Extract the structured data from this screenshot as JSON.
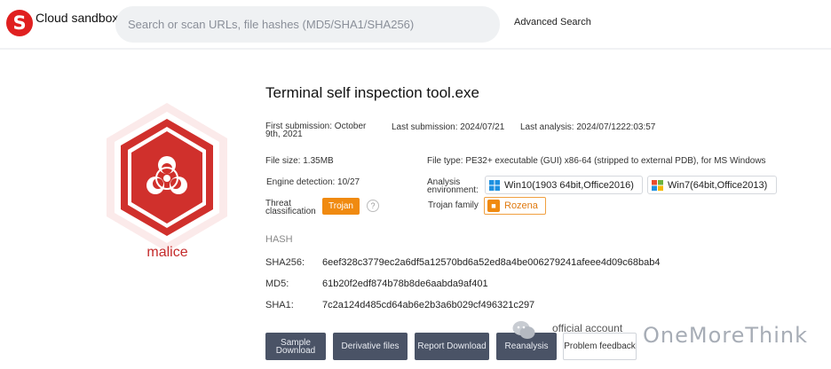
{
  "header": {
    "brand": "Cloud sandbox",
    "search_placeholder": "Search or scan URLs, file hashes (MD5/SHA1/SHA256)",
    "advanced_search": "Advanced Search"
  },
  "verdict": {
    "label": "malice",
    "icon": "biohazard-icon",
    "color": "#d0302c"
  },
  "file": {
    "name": "Terminal self inspection tool.exe",
    "first_submission": "First submission: October 9th, 2021",
    "last_submission": "Last submission: 2024/07/21",
    "last_analysis": "Last analysis: 2024/07/1222:03:57",
    "size": "File size: 1.35MB",
    "type": "File type: PE32+ executable (GUI) x86-64 (stripped to external PDB), for MS Windows",
    "engine_detection": "Engine detection: 10/27",
    "analysis_env_label": "Analysis environment:",
    "env_win10": "Win10(1903 64bit,Office2016)",
    "env_win7": "Win7(64bit,Office2013)",
    "threat_label": "Threat classification",
    "threat_value": "Trojan",
    "family_label": "Trojan family",
    "family_value": "Rozena"
  },
  "hash": {
    "heading": "HASH",
    "sha256_label": "SHA256:",
    "sha256": "6eef328c3779ec2a6df5a12570bd6a52ed8a4be006279241afeee4d09c68bab4",
    "md5_label": "MD5:",
    "md5": "61b20f2edf874b78b8de6aabda9af401",
    "sha1_label": "SHA1:",
    "sha1": "7c2a124d485cd64ab6e2b3a6b029cf496321c297"
  },
  "actions": {
    "sample_download": "Sample Download",
    "derivative_files": "Derivative files",
    "report_download": "Report Download",
    "reanalysis": "Reanalysis",
    "problem_feedback": "Problem feedback"
  },
  "watermark": {
    "official": "official account",
    "brand": "OneMoreThink"
  },
  "colors": {
    "accent": "#e02020",
    "tag_orange": "#f08a10",
    "button_dark": "#4a5366"
  }
}
